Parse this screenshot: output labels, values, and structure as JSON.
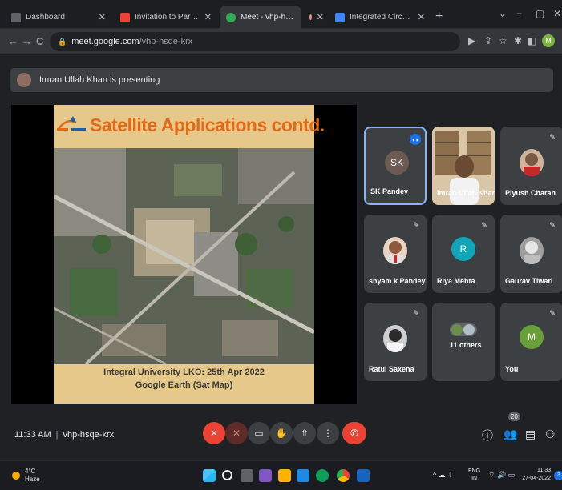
{
  "browser": {
    "tabs": [
      {
        "title": "Dashboard",
        "favicon_color": "#5f6368",
        "close": "✕"
      },
      {
        "title": "Invitation to Participate in Expert",
        "favicon_color": "#ea4335",
        "close": "✕"
      },
      {
        "title": "Meet - vhp-hsqe-krx",
        "favicon_color": "#34a853",
        "close": "",
        "active": true
      },
      {
        "title": "",
        "favicon_color": "#3c4043",
        "close": "✕"
      },
      {
        "title": "Integrated Circuits, Mosfets, OP",
        "favicon_color": "#4285f4",
        "close": "✕"
      }
    ],
    "new_tab": "+",
    "window_controls": [
      "⌄",
      "−",
      "▢",
      "✕"
    ],
    "nav": {
      "back": "←",
      "forward": "→",
      "reload": "C"
    },
    "url_host": "meet.google.com",
    "url_path": "/vhp-hsqe-krx",
    "profile_initial": "M"
  },
  "meet": {
    "presenting_text": "Imran Ullah Khan is presenting",
    "slide": {
      "title": "Satellite Applications contd.",
      "caption_line1": "Integral University LKO: 25th Apr 2022",
      "caption_line2": "Google Earth (Sat Map)"
    },
    "participants": [
      {
        "name": "SK Pandey",
        "initials": "SK",
        "avatar_color": "#6d5a53",
        "speaking": true
      },
      {
        "name": "Imran Ullah Khan",
        "initials": "",
        "avatar_color": "#a18a6f",
        "photo": true
      },
      {
        "name": "Piyush Charan",
        "initials": "",
        "avatar_color": "#d0b49a",
        "photo": true,
        "muted": true
      },
      {
        "name": "shyam k Pandey",
        "initials": "",
        "avatar_color": "#e8d6c3",
        "photo": true,
        "muted": true
      },
      {
        "name": "Riya Mehta",
        "initials": "R",
        "avatar_color": "#12a5b8",
        "muted": true
      },
      {
        "name": "Gaurav Tiwari",
        "initials": "",
        "avatar_color": "#9e9e9e",
        "photo": true,
        "muted": true
      },
      {
        "name": "Ratul Saxena",
        "initials": "",
        "avatar_color": "#cfcfcf",
        "photo": true,
        "muted": true
      },
      {
        "name": "11 others",
        "initials": "",
        "avatar_color": "#5f6368",
        "photo": true
      },
      {
        "name": "You",
        "initials": "M",
        "avatar_color": "#689f38",
        "muted": true
      }
    ],
    "time": "11:33 AM",
    "meeting_code": "vhp-hsqe-krx",
    "people_count": "20",
    "controls": {
      "mic": "✕",
      "camera": "✕",
      "captions": "▭",
      "raise_hand": "✋",
      "present": "⇧",
      "more": "⋮",
      "leave": "✆",
      "info": "ⓘ",
      "people": "👥",
      "chat": "▤",
      "activities": "⚇"
    }
  },
  "taskbar": {
    "weather_temp": "4°C",
    "weather_desc": "Haze",
    "lang_line1": "ENG",
    "lang_line2": "IN",
    "time": "11:33",
    "date": "27-04-2022",
    "notif_count": "3",
    "tray_icons": "^ ☁ ⇩",
    "tray_icons2": "⌔ 🔊 ▭"
  }
}
